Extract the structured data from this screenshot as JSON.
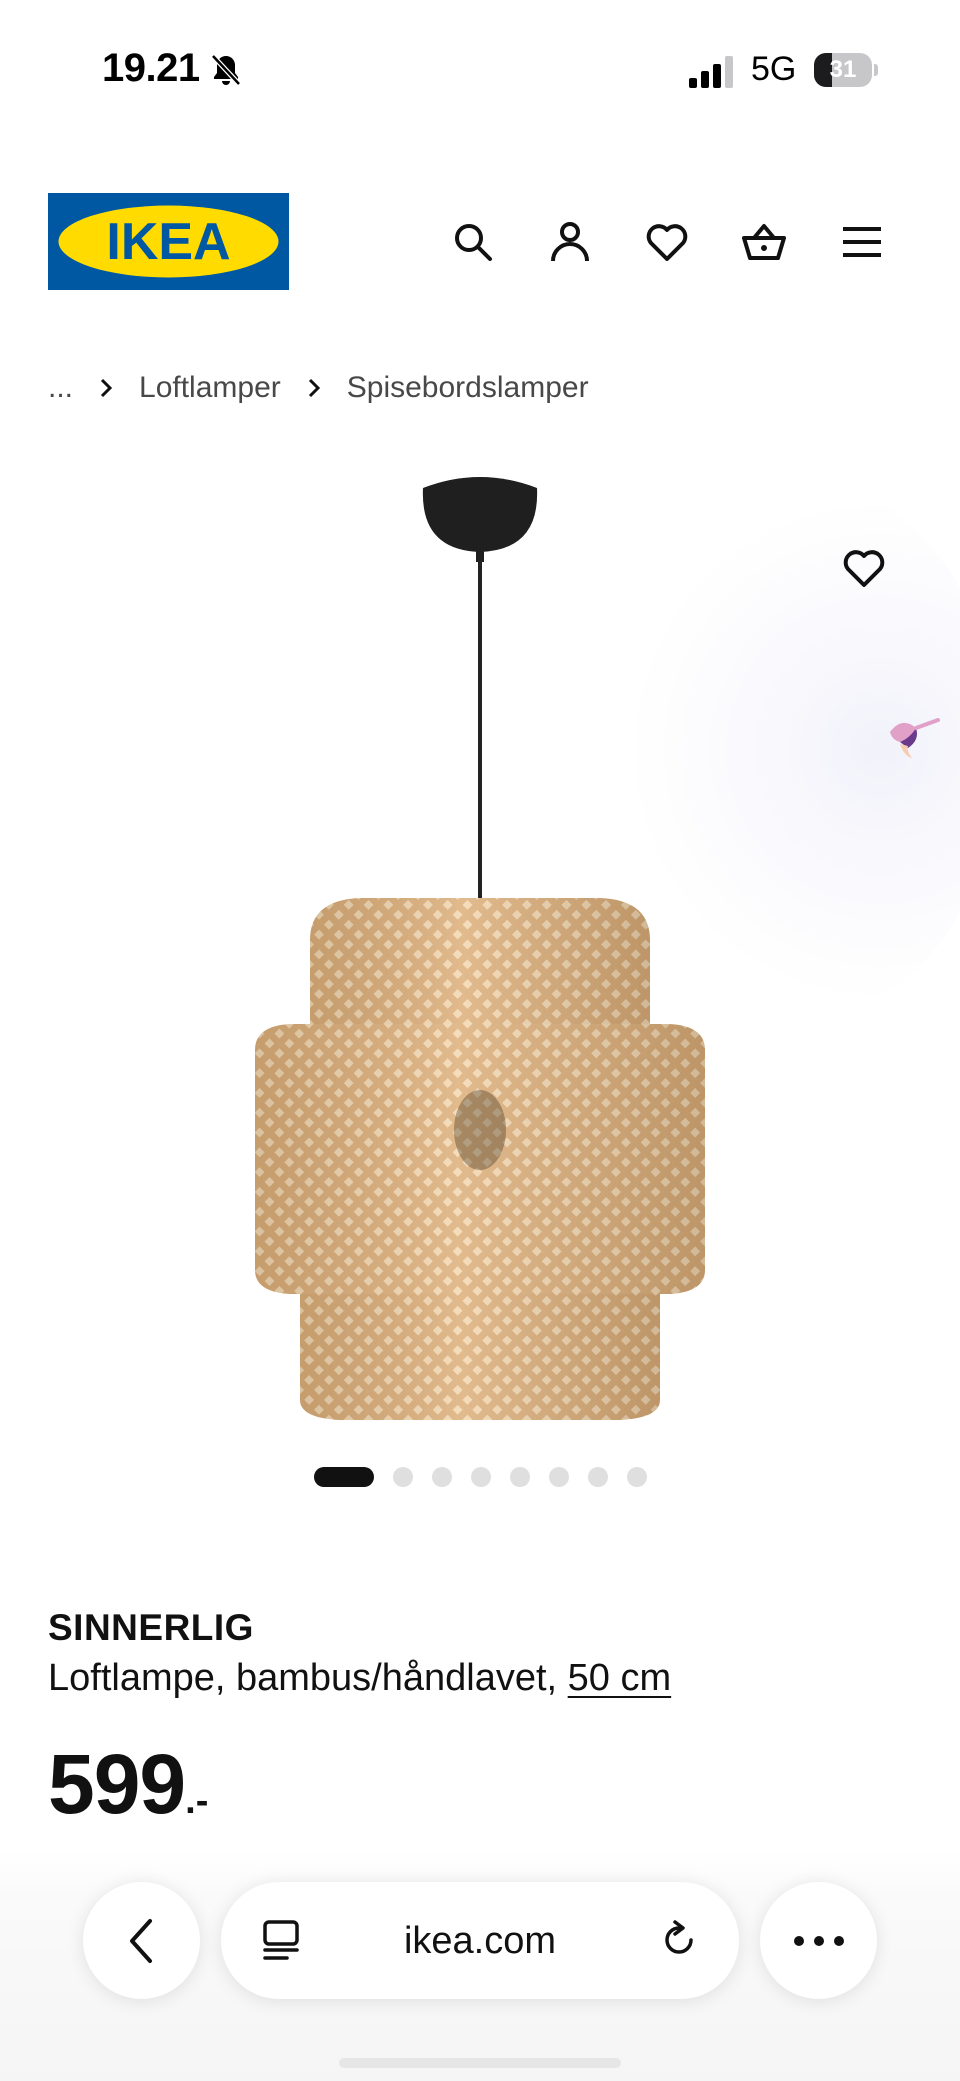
{
  "status_bar": {
    "time": "19.21",
    "network": "5G",
    "battery_level": "31",
    "battery_fraction": 0.31,
    "icons": [
      "bell-slash-icon",
      "signal-icon",
      "battery-icon"
    ]
  },
  "header": {
    "logo_text": "IKEA",
    "icons": [
      "search-icon",
      "account-icon",
      "heart-icon",
      "basket-icon",
      "menu-icon"
    ]
  },
  "breadcrumb": {
    "ellipsis": "...",
    "items": [
      "Loftlamper",
      "Spisebordslamper"
    ]
  },
  "product": {
    "name": "SINNERLIG",
    "description": "Loftlampe, bambus/håndlavet,",
    "size": "50 cm",
    "price": "599",
    "price_suffix": ".-",
    "image_count": 8,
    "active_image": 1
  },
  "browser": {
    "url": "ikea.com",
    "icons": [
      "back-icon",
      "reader-icon",
      "reload-icon",
      "more-icon"
    ]
  },
  "colors": {
    "ikea_blue": "#0058a3",
    "ikea_yellow": "#ffdb00",
    "text": "#111111",
    "muted": "#484848"
  }
}
